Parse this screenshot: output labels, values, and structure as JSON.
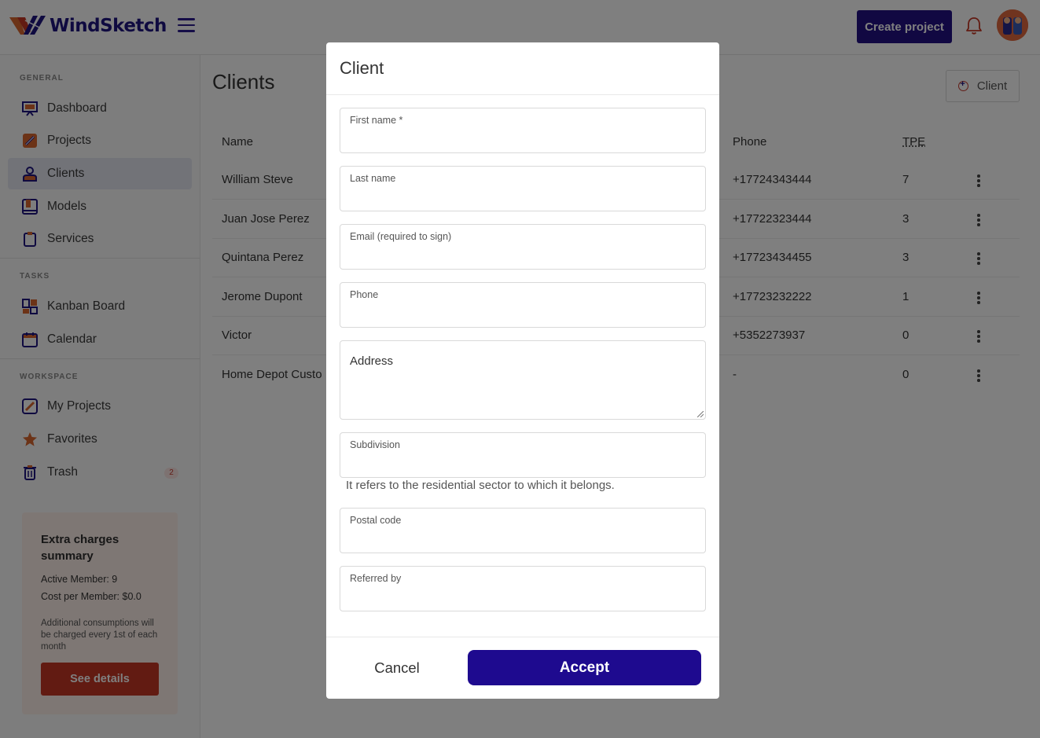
{
  "app": {
    "name": "WindSketch",
    "create_project_label": "Create project"
  },
  "sidebar": {
    "sections": {
      "general": "GENERAL",
      "tasks": "TASKS",
      "workspace": "WORKSPACE"
    },
    "items": [
      {
        "label": "Dashboard",
        "icon": "dashboard-icon"
      },
      {
        "label": "Projects",
        "icon": "projects-icon"
      },
      {
        "label": "Clients",
        "icon": "clients-icon",
        "active": true
      },
      {
        "label": "Models",
        "icon": "models-icon"
      },
      {
        "label": "Services",
        "icon": "services-icon"
      },
      {
        "label": "Kanban Board",
        "icon": "kanban-icon"
      },
      {
        "label": "Calendar",
        "icon": "calendar-icon"
      },
      {
        "label": "My Projects",
        "icon": "my-projects-icon"
      },
      {
        "label": "Favorites",
        "icon": "star-icon"
      },
      {
        "label": "Trash",
        "icon": "trash-icon",
        "badge": "2"
      }
    ],
    "extra_card": {
      "title": "Extra charges summary",
      "active_members": "Active Member: 9",
      "cost_per_member": "Cost per Member: $0.0",
      "note": "Additional consumptions will be charged every 1st of each month",
      "button_label": "See details"
    }
  },
  "main": {
    "title": "Clients",
    "add_button_label": "Client",
    "columns": {
      "name": "Name",
      "phone": "Phone",
      "tpe": "TPE"
    },
    "rows": [
      {
        "name": "William Steve",
        "phone": "+17724343444",
        "tpe": "7"
      },
      {
        "name": "Juan Jose Perez",
        "phone": "+17722323444",
        "tpe": "3"
      },
      {
        "name": "Quintana Perez",
        "phone": "+17723434455",
        "tpe": "3"
      },
      {
        "name": "Jerome Dupont",
        "phone": "+17723232222",
        "tpe": "1"
      },
      {
        "name": "Victor",
        "phone": "+5352273937",
        "tpe": "0"
      },
      {
        "name": "Home Depot Custo",
        "phone": "-",
        "tpe": "0"
      }
    ]
  },
  "modal": {
    "title": "Client",
    "fields": {
      "first_name": "First name *",
      "last_name": "Last name",
      "email": "Email (required to sign)",
      "phone": "Phone",
      "address_placeholder": "Address",
      "subdivision": "Subdivision",
      "subdivision_helper": "It refers to the residential sector to which it belongs.",
      "postal_code": "Postal code",
      "referred_by": "Referred by"
    },
    "cancel_label": "Cancel",
    "accept_label": "Accept"
  },
  "colors": {
    "brand": "#1f1580",
    "accent": "#c43724",
    "overlay": "rgba(0,0,0,0.5)"
  }
}
